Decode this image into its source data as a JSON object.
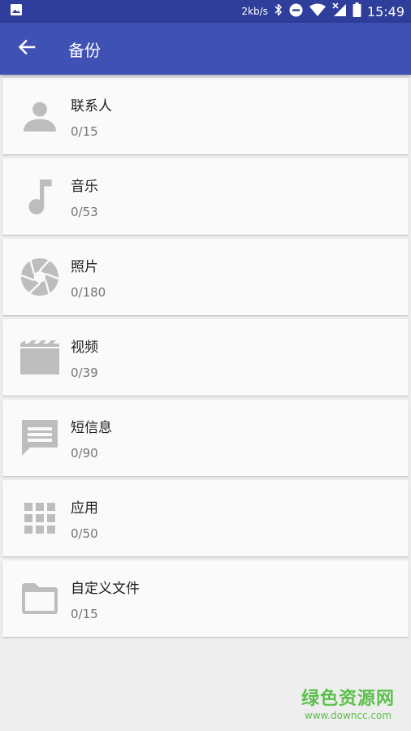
{
  "status_bar": {
    "net_speed": "2kb/s",
    "time": "15:49",
    "icons": [
      "image-icon",
      "bluetooth-icon",
      "dnd-icon",
      "wifi-icon",
      "signal-icon",
      "battery-icon"
    ]
  },
  "app_bar": {
    "title": "备份",
    "back_icon": "arrow-back-icon"
  },
  "items": [
    {
      "icon": "contacts-icon",
      "title": "联系人",
      "count": "0/15"
    },
    {
      "icon": "music-icon",
      "title": "音乐",
      "count": "0/53"
    },
    {
      "icon": "camera-aperture-icon",
      "title": "照片",
      "count": "0/180"
    },
    {
      "icon": "video-clapper-icon",
      "title": "视频",
      "count": "0/39"
    },
    {
      "icon": "message-icon",
      "title": "短信息",
      "count": "0/90"
    },
    {
      "icon": "apps-grid-icon",
      "title": "应用",
      "count": "0/50"
    },
    {
      "icon": "folder-icon",
      "title": "自定义文件",
      "count": "0/15"
    }
  ],
  "colors": {
    "primary": "#3f51b5",
    "status_bar": "#2f3d9b",
    "icon_gray": "#bdbdbd",
    "background": "#eeeeee"
  },
  "watermark": {
    "name": "绿色资源网",
    "url": "www.downcc.com"
  }
}
